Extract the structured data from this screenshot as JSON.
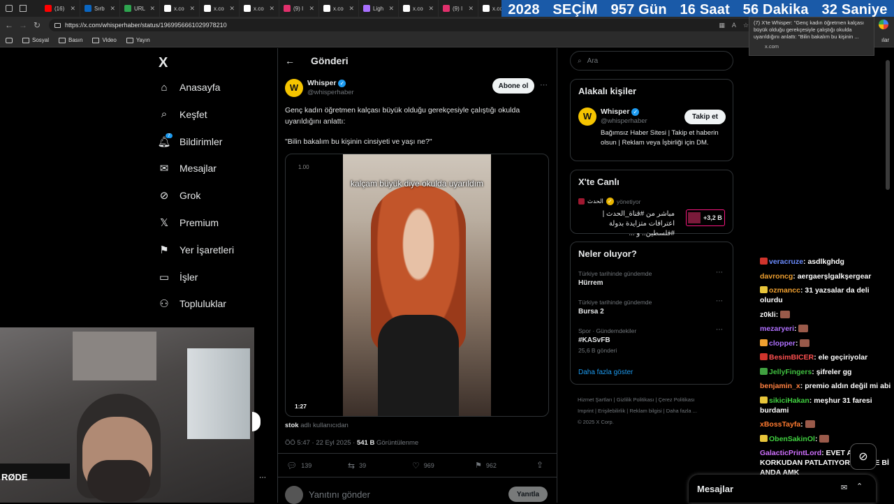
{
  "browser": {
    "tabs": [
      {
        "title": "(16)",
        "color": "#ff0000"
      },
      {
        "title": "Sırb",
        "color": "#0a66c2"
      },
      {
        "title": "URL",
        "color": "#2ea44f"
      },
      {
        "title": "x.co",
        "color": "#ffffff"
      },
      {
        "title": "x.co",
        "color": "#ffffff"
      },
      {
        "title": "x.co",
        "color": "#ffffff"
      },
      {
        "title": "(9) I",
        "color": "#e1306c"
      },
      {
        "title": "x.co",
        "color": "#ffffff"
      },
      {
        "title": "Ligh",
        "color": "#a970ff"
      },
      {
        "title": "x.co",
        "color": "#ffffff"
      },
      {
        "title": "(9) I",
        "color": "#e1306c"
      },
      {
        "title": "x.co",
        "color": "#ffffff"
      }
    ],
    "url": "https://x.com/whisperhaber/status/1969956661029978210",
    "bookmarks": [
      "Sosyal",
      "Basın",
      "Video",
      "Yayın"
    ],
    "tooltip_title": "(7) X'te Whisper: \"Genç kadın öğretmen kalçası büyük olduğu gerekçesiyle çalıştığı okulda uyarıldığını anlattı: \"Bilin bakalım bu kişinin ...",
    "tooltip_domain": "x.com",
    "tail_text": "ılar"
  },
  "banner": {
    "year": "2028",
    "label": "SEÇİM",
    "days": "957 Gün",
    "hours": "16 Saat",
    "minutes": "56 Dakika",
    "seconds": "32 Saniye"
  },
  "nav": {
    "logo": "X",
    "items": [
      {
        "label": "Anasayfa",
        "icon": "home-icon"
      },
      {
        "label": "Keşfet",
        "icon": "search-icon"
      },
      {
        "label": "Bildirimler",
        "icon": "bell-icon",
        "badge": "7"
      },
      {
        "label": "Mesajlar",
        "icon": "mail-icon"
      },
      {
        "label": "Grok",
        "icon": "grok-icon"
      },
      {
        "label": "Premium",
        "icon": "x-icon"
      },
      {
        "label": "Yer İşaretleri",
        "icon": "bookmark-icon"
      },
      {
        "label": "İşler",
        "icon": "briefcase-icon"
      },
      {
        "label": "Topluluklar",
        "icon": "people-icon"
      }
    ]
  },
  "post": {
    "header": "Gönderi",
    "author_name": "Whisper",
    "author_handle": "@whisperhaber",
    "subscribe_label": "Abone ol",
    "text_line1": "Genç kadın öğretmen kalçası büyük olduğu gerekçesiyle çalıştığı okulda uyarıldığını anlattı:",
    "text_line2": "\"Bilin bakalım bu kişinin cinsiyeti ve yaşı ne?\"",
    "video_caption": "kalçam büyük diye okulda uyarıldım",
    "video_speed": "1.00",
    "video_duration": "1:27",
    "source_user": "stok",
    "source_suffix": "adlı kullanıcıdan",
    "timestamp": "ÖÖ 5:47 · 22 Eyl 2025 ·",
    "views_count": "541 B",
    "views_label": "Görüntülenme",
    "replies": "139",
    "reposts": "39",
    "likes": "969",
    "bookmarks": "962",
    "reply_placeholder": "Yanıtını gönder",
    "reply_button": "Yanıtla"
  },
  "search": {
    "placeholder": "Ara"
  },
  "related": {
    "title": "Alakalı kişiler",
    "name": "Whisper",
    "handle": "@whisperhaber",
    "follow_label": "Takip et",
    "bio": "Bağımsız Haber Sitesi | Takip et haberin olsun | Reklam veya İşbirliği için DM."
  },
  "live": {
    "title": "X'te Canlı",
    "host": "الحدث",
    "host_suffix": "yönetiyor",
    "stream_title": "مباشر من #قناة_الحدث | اعترافات متزايدة بدولة #فلسطين.. و ...",
    "listeners": "+3,2 B"
  },
  "trends": {
    "title": "Neler oluyor?",
    "items": [
      {
        "category": "Türkiye tarihinde gündemde",
        "name": "Hürrem",
        "count": ""
      },
      {
        "category": "Türkiye tarihinde gündemde",
        "name": "Bursa 2",
        "count": ""
      },
      {
        "category": "Spor · Gündemdekiler",
        "name": "#KASvFB",
        "count": "25,6 B gönderi"
      }
    ],
    "more": "Daha fazla göster"
  },
  "footer": {
    "line1": [
      "Hizmet Şartları",
      "Gizlilik Politikası",
      "Çerez Politikası"
    ],
    "line2": [
      "Imprint",
      "Erişilebilirlik",
      "Reklam bilgisi",
      "Daha fazla ..."
    ],
    "copyright": "© 2025 X Corp."
  },
  "messages_drawer": {
    "label": "Mesajlar"
  },
  "webcam": {
    "brand": "RØDE"
  },
  "chat": [
    {
      "user": "veracruze",
      "color": "#6b8cff",
      "badge": "#d0342c",
      "text": "asdlkghdg"
    },
    {
      "user": "davroncg",
      "color": "#f0a030",
      "badge": "",
      "text": "aergaerşlgalkşergear"
    },
    {
      "user": "ozmancc",
      "color": "#f0a030",
      "badge": "#e8c53a",
      "text": "31 yazsalar da deli olurdu"
    },
    {
      "user": "z0kli",
      "color": "#ffffff",
      "badge": "",
      "text": "",
      "emote": true
    },
    {
      "user": "mezaryeri",
      "color": "#b070ff",
      "badge": "",
      "text": "",
      "emote": true
    },
    {
      "user": "clopper",
      "color": "#b070ff",
      "badge": "#f0a030",
      "text": "",
      "emote": true
    },
    {
      "user": "BesimBICER",
      "color": "#ff5050",
      "badge": "#d0342c",
      "text": "ele geçiriyolar"
    },
    {
      "user": "JellyFingers",
      "color": "#40c040",
      "badge": "#40a040",
      "text": "şifreler gg"
    },
    {
      "user": "benjamin_x",
      "color": "#ff8040",
      "badge": "",
      "text": "premio aldın değil mi abi"
    },
    {
      "user": "sikiciHakan",
      "color": "#40d040",
      "badge": "#e8c53a",
      "text": "meşhur 31 faresi burdami"
    },
    {
      "user": "xBossTayfa",
      "color": "#ff7a30",
      "badge": "",
      "text": "",
      "emote": true
    },
    {
      "user": "ObenSakinOl",
      "color": "#40d040",
      "badge": "#e8c53a",
      "text": "",
      "emote": true
    },
    {
      "user": "GalacticPrintLord",
      "color": "#d070ff",
      "badge": "",
      "text": "EVET AMK KORKUDAN PATLATIYOR BENİDE Bİ ANDA AMK"
    }
  ]
}
